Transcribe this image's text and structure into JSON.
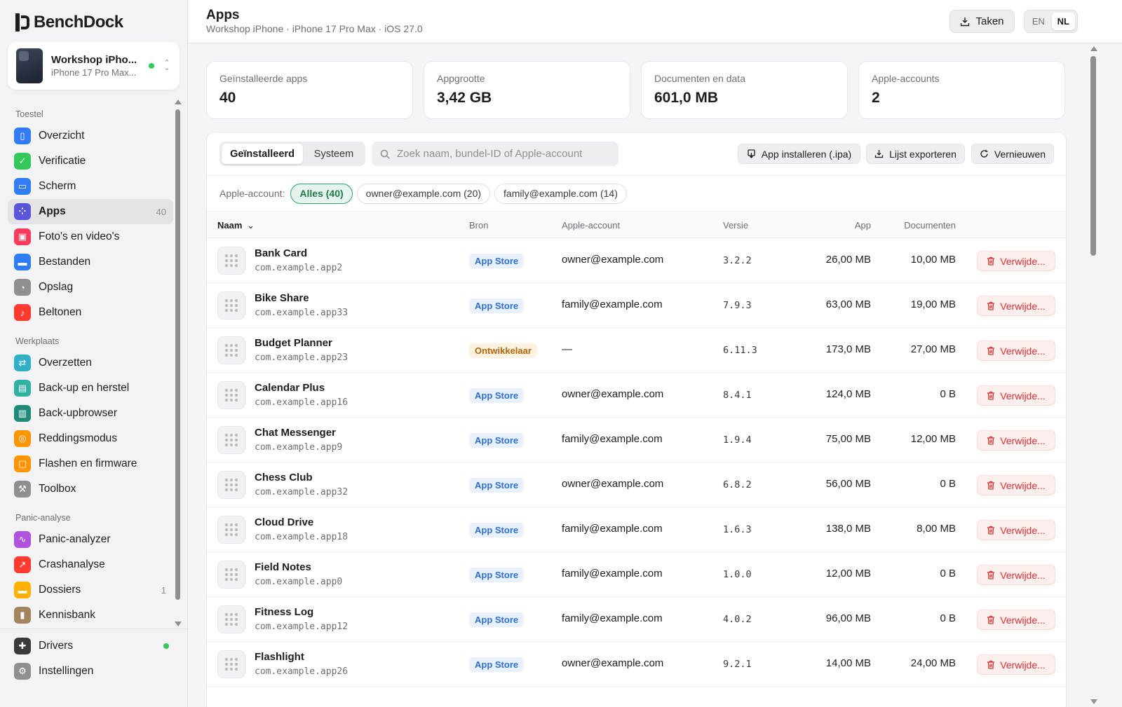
{
  "brand": {
    "name_a": "Bench",
    "name_b": "Dock"
  },
  "device": {
    "name": "Workshop iPho...",
    "model": "iPhone 17 Pro Max..."
  },
  "sidebar": {
    "sections": [
      {
        "label": "Toestel",
        "items": [
          {
            "label": "Overzicht",
            "icon": "phone-icon",
            "color": "#2f7cf6"
          },
          {
            "label": "Verificatie",
            "icon": "shield-check-icon",
            "color": "#34c759"
          },
          {
            "label": "Scherm",
            "icon": "screen-icon",
            "color": "#2f7cf6"
          },
          {
            "label": "Apps",
            "icon": "apps-grid-icon",
            "color": "#5856d6",
            "count": "40",
            "active": true
          },
          {
            "label": "Foto's en video's",
            "icon": "photo-icon",
            "color": "#ff3b5c"
          },
          {
            "label": "Bestanden",
            "icon": "folder-icon",
            "color": "#2f7cf6"
          },
          {
            "label": "Opslag",
            "icon": "pie-icon",
            "color": "#8e8e93"
          },
          {
            "label": "Beltonen",
            "icon": "music-note-icon",
            "color": "#ff3b30"
          }
        ]
      },
      {
        "label": "Werkplaats",
        "items": [
          {
            "label": "Overzetten",
            "icon": "transfer-icon",
            "color": "#30b0c7"
          },
          {
            "label": "Back-up en herstel",
            "icon": "archive-icon",
            "color": "#30b0a0"
          },
          {
            "label": "Back-upbrowser",
            "icon": "browser-icon",
            "color": "#1f8a78"
          },
          {
            "label": "Reddingsmodus",
            "icon": "lifebuoy-icon",
            "color": "#ff9500"
          },
          {
            "label": "Flashen en firmware",
            "icon": "chip-icon",
            "color": "#ff9500"
          },
          {
            "label": "Toolbox",
            "icon": "wrench-icon",
            "color": "#8e8e93"
          }
        ]
      },
      {
        "label": "Panic-analyse",
        "items": [
          {
            "label": "Panic-analyzer",
            "icon": "pulse-icon",
            "color": "#af52de"
          },
          {
            "label": "Crashanalyse",
            "icon": "trend-icon",
            "color": "#ff3b30"
          },
          {
            "label": "Dossiers",
            "icon": "folder-stack-icon",
            "color": "#ffb000",
            "count": "1"
          },
          {
            "label": "Kennisbank",
            "icon": "book-icon",
            "color": "#a2845e"
          }
        ]
      }
    ],
    "footer": [
      {
        "label": "Drivers",
        "icon": "puzzle-icon",
        "color": "#3a3a3c",
        "status_dot": true
      },
      {
        "label": "Instellingen",
        "icon": "gear-icon",
        "color": "#8e8e93"
      }
    ]
  },
  "header": {
    "title": "Apps",
    "subtitle": "Workshop iPhone · iPhone 17 Pro Max · iOS 27.0",
    "tasks_label": "Taken",
    "lang": {
      "en": "EN",
      "nl": "NL",
      "active": "NL"
    }
  },
  "stats": [
    {
      "label": "Geïnstalleerde apps",
      "value": "40"
    },
    {
      "label": "Appgrootte",
      "value": "3,42 GB"
    },
    {
      "label": "Documenten en data",
      "value": "601,0 MB"
    },
    {
      "label": "Apple-accounts",
      "value": "2"
    }
  ],
  "toolbar": {
    "tab_installed": "Geïnstalleerd",
    "tab_system": "Systeem",
    "search_placeholder": "Zoek naam, bundel-ID of Apple-account",
    "install_label": "App installeren (.ipa)",
    "export_label": "Lijst exporteren",
    "refresh_label": "Vernieuwen"
  },
  "filters": {
    "label": "Apple-account:",
    "chips": [
      {
        "label": "Alles (40)",
        "active": true
      },
      {
        "label": "owner@example.com (20)"
      },
      {
        "label": "family@example.com (14)"
      }
    ]
  },
  "table": {
    "columns": {
      "name": "Naam",
      "source": "Bron",
      "account": "Apple-account",
      "version": "Versie",
      "app": "App",
      "docs": "Documenten"
    },
    "delete_label": "Verwijde...",
    "rows": [
      {
        "name": "Bank Card",
        "bundle": "com.example.app2",
        "source": "App Store",
        "source_type": "store",
        "account": "owner@example.com",
        "version": "3.2.2",
        "app": "26,00 MB",
        "docs": "10,00 MB"
      },
      {
        "name": "Bike Share",
        "bundle": "com.example.app33",
        "source": "App Store",
        "source_type": "store",
        "account": "family@example.com",
        "version": "7.9.3",
        "app": "63,00 MB",
        "docs": "19,00 MB"
      },
      {
        "name": "Budget Planner",
        "bundle": "com.example.app23",
        "source": "Ontwikkelaar",
        "source_type": "dev",
        "account": "—",
        "version": "6.11.3",
        "app": "173,0 MB",
        "docs": "27,00 MB"
      },
      {
        "name": "Calendar Plus",
        "bundle": "com.example.app16",
        "source": "App Store",
        "source_type": "store",
        "account": "owner@example.com",
        "version": "8.4.1",
        "app": "124,0 MB",
        "docs": "0 B"
      },
      {
        "name": "Chat Messenger",
        "bundle": "com.example.app9",
        "source": "App Store",
        "source_type": "store",
        "account": "family@example.com",
        "version": "1.9.4",
        "app": "75,00 MB",
        "docs": "12,00 MB"
      },
      {
        "name": "Chess Club",
        "bundle": "com.example.app32",
        "source": "App Store",
        "source_type": "store",
        "account": "owner@example.com",
        "version": "6.8.2",
        "app": "56,00 MB",
        "docs": "0 B"
      },
      {
        "name": "Cloud Drive",
        "bundle": "com.example.app18",
        "source": "App Store",
        "source_type": "store",
        "account": "family@example.com",
        "version": "1.6.3",
        "app": "138,0 MB",
        "docs": "8,00 MB"
      },
      {
        "name": "Field Notes",
        "bundle": "com.example.app0",
        "source": "App Store",
        "source_type": "store",
        "account": "family@example.com",
        "version": "1.0.0",
        "app": "12,00 MB",
        "docs": "0 B"
      },
      {
        "name": "Fitness Log",
        "bundle": "com.example.app12",
        "source": "App Store",
        "source_type": "store",
        "account": "family@example.com",
        "version": "4.0.2",
        "app": "96,00 MB",
        "docs": "0 B"
      },
      {
        "name": "Flashlight",
        "bundle": "com.example.app26",
        "source": "App Store",
        "source_type": "store",
        "account": "owner@example.com",
        "version": "9.2.1",
        "app": "14,00 MB",
        "docs": "24,00 MB"
      }
    ]
  }
}
